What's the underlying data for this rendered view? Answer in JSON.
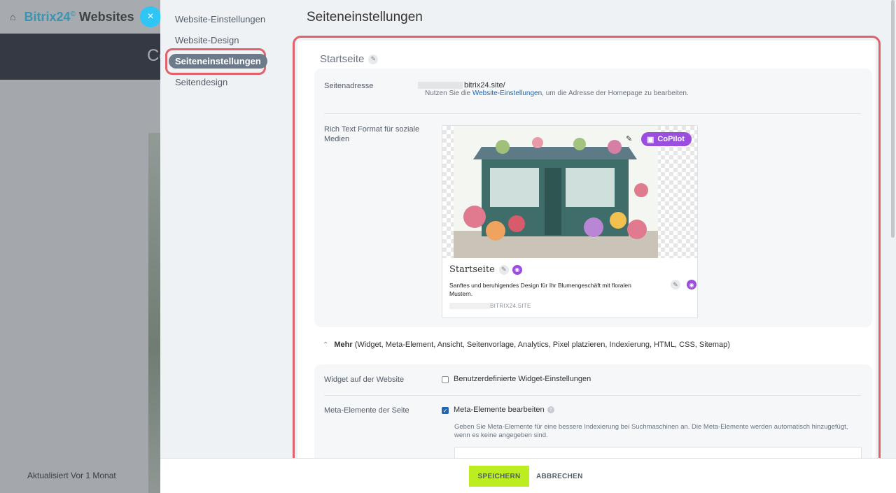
{
  "background": {
    "brand_name": "Bitrix24",
    "brand_suffix": "Websites",
    "close_glyph": "×",
    "banner_text": "Co",
    "updated_text": "Aktualisiert Vor 1 Monat"
  },
  "nav": {
    "items": [
      {
        "label": "Website-Einstellungen"
      },
      {
        "label": "Website-Design"
      },
      {
        "label": "Seiteneinstellungen"
      },
      {
        "label": "Seitendesign"
      }
    ]
  },
  "page_title": "Seiteneinstellungen",
  "section": {
    "title": "Startseite",
    "address": {
      "label": "Seitenadresse",
      "value": "bitrix24.site/",
      "hint_prefix": "Nutzen Sie die ",
      "hint_link": "Website-Einstellungen",
      "hint_suffix": ", um die Adresse der Homepage zu bearbeiten."
    },
    "rich_text": {
      "label": "Rich Text Format für soziale Medien",
      "copilot_label": "CoPilot",
      "preview_title": "Startseite",
      "preview_description": "Sanftes und beruhigendes Design für Ihr Blumengeschäft mit floralen Mustern.",
      "preview_domain": "BITRIX24.SITE"
    }
  },
  "more": {
    "label": "Mehr",
    "details": "(Widget,  Meta-Element,  Ansicht,  Seitenvorlage,  Analytics,  Pixel platzieren,  Indexierung,  HTML,  CSS,  Sitemap)"
  },
  "widget": {
    "label": "Widget auf der Website",
    "checkbox_label": "Benutzerdefinierte Widget-Einstellungen",
    "checked": false
  },
  "meta": {
    "label": "Meta-Elemente der Seite",
    "checkbox_label": "Meta-Elemente bearbeiten",
    "checked": true,
    "hint": "Geben Sie Meta-Elemente für eine bessere Indexierung bei Suchmaschinen an. Die Meta-Elemente werden automatisch hinzugefügt, wenn es keine angegeben sind."
  },
  "footer": {
    "save_label": "SPEICHERN",
    "cancel_label": "ABBRECHEN"
  },
  "colors": {
    "highlight": "#e0626a",
    "save_button": "#bbed21",
    "copilot": "#9b4de0",
    "link": "#2067b0"
  }
}
